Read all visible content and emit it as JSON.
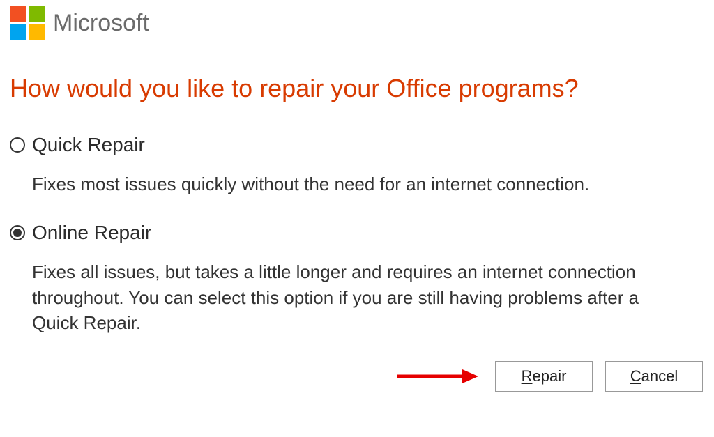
{
  "header": {
    "brand": "Microsoft"
  },
  "title": "How would you like to repair your Office programs?",
  "options": [
    {
      "id": "quick",
      "label": "Quick Repair",
      "description": "Fixes most issues quickly without the need for an internet connection.",
      "selected": false
    },
    {
      "id": "online",
      "label": "Online Repair",
      "description": "Fixes all issues, but takes a little longer and requires an internet connection throughout. You can select this option if you are still having problems after a Quick Repair.",
      "selected": true
    }
  ],
  "buttons": {
    "repair": {
      "prefix": "R",
      "rest": "epair"
    },
    "cancel": {
      "prefix": "C",
      "rest": "ancel"
    }
  },
  "annotation": {
    "arrow_color": "#e60000"
  }
}
